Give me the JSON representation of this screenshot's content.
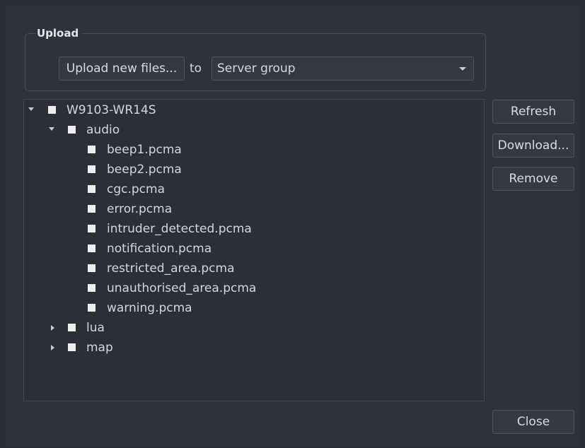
{
  "upload": {
    "group_title": "Upload",
    "upload_button": "Upload new files...",
    "to_label": "to",
    "target_select": "Server group"
  },
  "tree": {
    "root": "W9103-WR14S",
    "folders": [
      {
        "name": "audio",
        "expanded": true,
        "files": [
          "beep1.pcma",
          "beep2.pcma",
          "cgc.pcma",
          "error.pcma",
          "intruder_detected.pcma",
          "notification.pcma",
          "restricted_area.pcma",
          "unauthorised_area.pcma",
          "warning.pcma"
        ]
      },
      {
        "name": "lua",
        "expanded": false
      },
      {
        "name": "map",
        "expanded": false
      }
    ]
  },
  "actions": {
    "refresh": "Refresh",
    "download": "Download...",
    "remove": "Remove",
    "close": "Close"
  }
}
